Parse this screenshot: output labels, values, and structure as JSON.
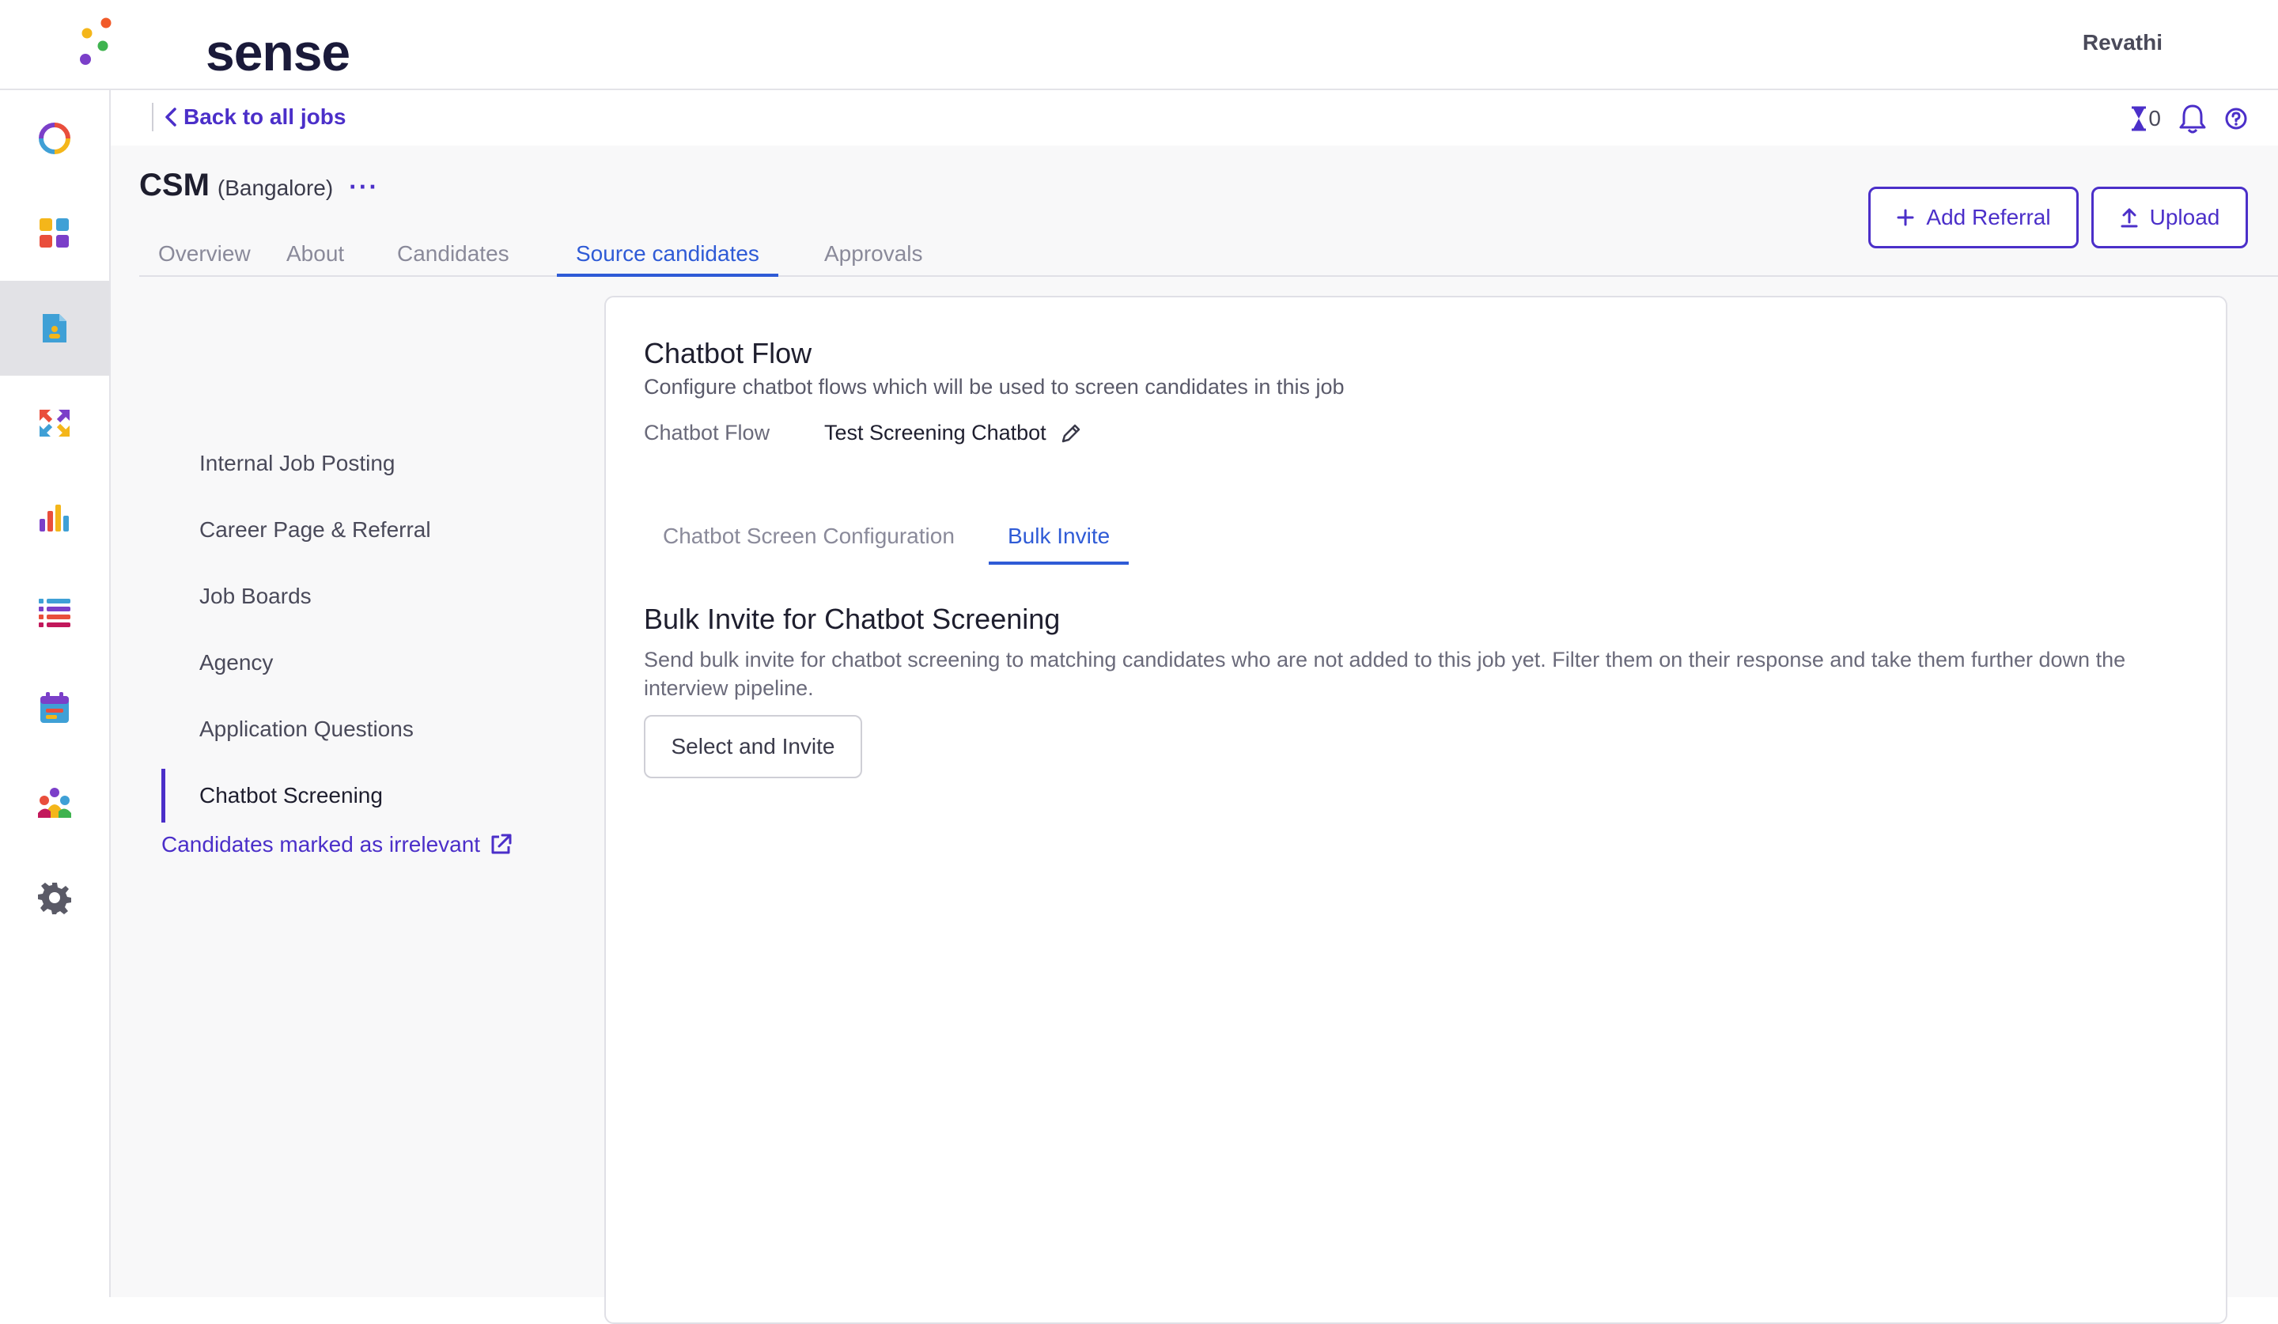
{
  "app": {
    "logo_text": "sense",
    "user_name": "Revathi"
  },
  "nav": {
    "back_label": "Back to all jobs",
    "hourglass_count": "0"
  },
  "job": {
    "title": "CSM",
    "location": "(Bangalore)",
    "more": "···"
  },
  "tabs": [
    {
      "label": "Overview"
    },
    {
      "label": "About"
    },
    {
      "label": "Candidates"
    },
    {
      "label": "Source candidates",
      "active": true
    },
    {
      "label": "Approvals"
    }
  ],
  "actions": {
    "add_referral": "Add Referral",
    "upload": "Upload"
  },
  "submenu": {
    "items": [
      {
        "label": "Internal Job Posting"
      },
      {
        "label": "Career Page & Referral"
      },
      {
        "label": "Job Boards"
      },
      {
        "label": "Agency"
      },
      {
        "label": "Application Questions"
      },
      {
        "label": "Chatbot Screening",
        "active": true
      }
    ],
    "irrelevant_link": "Candidates marked as irrelevant"
  },
  "card": {
    "title": "Chatbot Flow",
    "description": "Configure chatbot flows which will be used to screen candidates in this job",
    "flow_label": "Chatbot Flow",
    "flow_value": "Test Screening Chatbot",
    "inner_tabs": [
      {
        "label": "Chatbot Screen Configuration"
      },
      {
        "label": "Bulk Invite",
        "active": true
      }
    ],
    "section_title": "Bulk Invite for Chatbot Screening",
    "section_desc": "Send bulk invite for chatbot screening to matching candidates who are not added to this job yet. Filter them on their response and take them further down the interview pipeline.",
    "select_button": "Select and Invite"
  },
  "colors": {
    "brand_purple": "#4b2fc9",
    "tab_blue": "#2f5bd6",
    "rail_active": "#e2e2e6"
  },
  "icons": {
    "rail": [
      "ring-icon",
      "dashboard-icon",
      "jobs-icon",
      "sourcing-icon",
      "analytics-icon",
      "list-icon",
      "calendar-icon",
      "team-icon",
      "settings-icon"
    ]
  }
}
